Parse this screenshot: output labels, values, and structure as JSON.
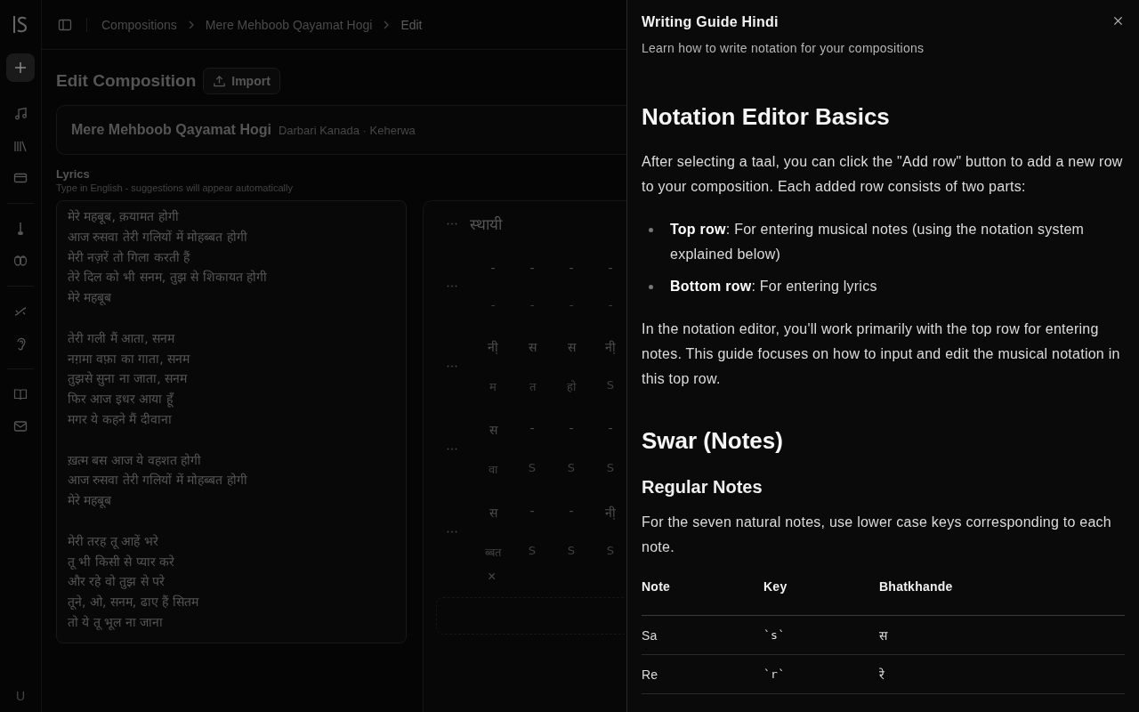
{
  "sidebar": {
    "items": [
      {
        "kind": "add"
      },
      {
        "kind": "music"
      },
      {
        "kind": "library"
      },
      {
        "kind": "card"
      },
      {
        "kind": "divider"
      },
      {
        "kind": "sitar"
      },
      {
        "kind": "tabla"
      },
      {
        "kind": "divider"
      },
      {
        "kind": "link"
      },
      {
        "kind": "ear"
      },
      {
        "kind": "divider"
      },
      {
        "kind": "book"
      },
      {
        "kind": "mail"
      }
    ],
    "user_initial": "U"
  },
  "breadcrumb": [
    "Compositions",
    "Mere Mehboob Qayamat Hogi",
    "Edit"
  ],
  "page_title": "Edit Composition",
  "import_button": "Import",
  "composition": {
    "title": "Mere Mehboob Qayamat Hogi",
    "subtitle": "Darbari Kanada · Keherwa"
  },
  "lyrics": {
    "label": "Lyrics",
    "hint": "Type in English - suggestions will appear automatically",
    "value": "मेरे महबूब, क़यामत होगी\nआज रुसवा तेरी गलियों में मोहब्बत होगी\nमेरी नज़रें तो गिला करती हैं\nतेरे दिल को भी सनम, तुझ से शिकायत होगी\nमेरे महबूब\n\nतेरी गली मैं आता, सनम\nनग़मा वफ़ा का गाता, सनम\nतुझसे सुना ना जाता, सनम\nफिर आज इधर आया हूँ\nमगर ये कहने मैं दीवाना\n\nख़त्म बस आज ये वहशत होगी\nआज रुसवा तेरी गलियों में मोहब्बत होगी\nमेरे महबूब\n\nमेरी तरह तू आहें भरे\nतू भी किसी से प्यार करे\nऔर रहे वो तुझ से परे\nतूने, ओ, सनम, ढाए हैं सितम\nतो ये तू भूल ना जाना"
  },
  "notation": {
    "section_title": "स्थायी",
    "rows": [
      {
        "notes": [
          "-",
          "-",
          "-",
          "-"
        ],
        "syllables": [
          "-",
          "-",
          "-",
          "-"
        ]
      },
      {
        "notes": [
          "नी़",
          "स",
          "स",
          "नी़"
        ],
        "syllables": [
          "म",
          "त",
          "हो",
          "S"
        ]
      },
      {
        "notes": [
          "स",
          "-",
          "-",
          "-"
        ],
        "syllables": [
          "वा",
          "S",
          "S",
          "S"
        ]
      },
      {
        "notes": [
          "स",
          "-",
          "-",
          "नी़"
        ],
        "syllables": [
          "ब्बत",
          "S",
          "S",
          "S"
        ]
      }
    ],
    "remove": "×"
  },
  "drawer": {
    "title": "Writing Guide Hindi",
    "subtitle": "Learn how to write notation for your compositions",
    "blocks": [
      {
        "kind": "h2",
        "text": "Notation Editor Basics"
      },
      {
        "kind": "p",
        "text": "After selecting a taal, you can click the \"Add row\" button to add a new row to your composition. Each added row consists of two parts:"
      },
      {
        "kind": "ul",
        "items": [
          "**Top row**: For entering musical notes (using the notation system explained below)",
          "**Bottom row**: For entering lyrics"
        ]
      },
      {
        "kind": "p",
        "text": "In the notation editor, you'll work primarily with the top row for entering notes. This guide focuses on how to input and edit the musical notation in this top row."
      },
      {
        "kind": "h2",
        "text": "Swar (Notes)"
      },
      {
        "kind": "h3",
        "text": "Regular Notes"
      },
      {
        "kind": "p",
        "text": "For the seven natural notes, use lower case keys corresponding to each note."
      },
      {
        "kind": "table",
        "columns": [
          "Note",
          "Key",
          "Bhatkhande"
        ],
        "rows": [
          [
            "Sa",
            "`s`",
            "स"
          ],
          [
            "Re",
            "`r`",
            "रे"
          ]
        ]
      }
    ]
  }
}
